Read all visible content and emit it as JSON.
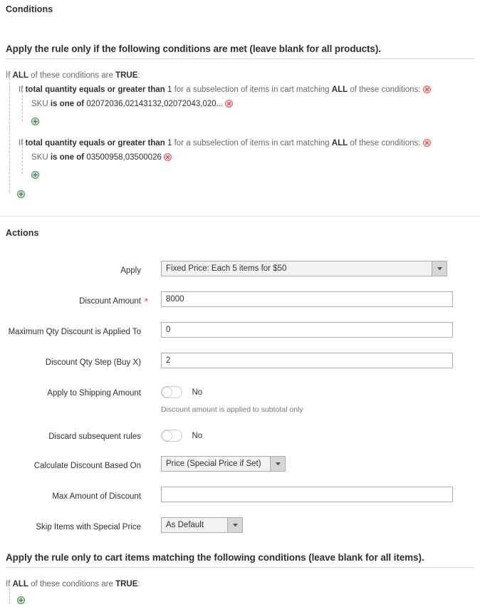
{
  "conditions_section": {
    "title": "Conditions",
    "description": "Apply the rule only if the following conditions are met (leave blank for all products).",
    "root": {
      "prefix": "If",
      "aggregator": "ALL",
      "middle": "of these conditions are",
      "value": "TRUE",
      "suffix": ":"
    },
    "groups": [
      {
        "prefix": "If",
        "attribute": "total quantity",
        "operator": "equals or greater than",
        "value": "1",
        "middle": "for a subselection of items in cart matching",
        "aggregator": "ALL",
        "suffix": "of these conditions:",
        "remove_icon": "remove-circle-icon",
        "children": [
          {
            "attribute": "SKU",
            "operator": "is one of",
            "value": "02072036,02143132,02072043,020...",
            "remove_icon": "remove-circle-icon"
          }
        ],
        "add_icon": "add-circle-icon"
      },
      {
        "prefix": "If",
        "attribute": "total quantity",
        "operator": "equals or greater than",
        "value": "1",
        "middle": "for a subselection of items in cart matching",
        "aggregator": "ALL",
        "suffix": "of these conditions:",
        "remove_icon": "remove-circle-icon",
        "children": [
          {
            "attribute": "SKU",
            "operator": "is one of",
            "value": "03500958,03500026",
            "remove_icon": "remove-circle-icon"
          }
        ],
        "add_icon": "add-circle-icon"
      }
    ],
    "root_add_icon": "add-circle-icon"
  },
  "actions_section": {
    "title": "Actions",
    "fields": {
      "apply": {
        "label": "Apply",
        "value": "Fixed Price: Each 5 items for $50",
        "arrow_icon": "chevron-down-icon"
      },
      "discount_amount": {
        "label": "Discount Amount",
        "required_marker": "*",
        "value": "8000"
      },
      "max_qty": {
        "label": "Maximum Qty Discount is Applied To",
        "value": "0"
      },
      "qty_step": {
        "label": "Discount Qty Step (Buy X)",
        "value": "2"
      },
      "apply_shipping": {
        "label": "Apply to Shipping Amount",
        "toggle_state": "No",
        "note": "Discount amount is applied to subtotal only"
      },
      "discard_rules": {
        "label": "Discard subsequent rules",
        "toggle_state": "No"
      },
      "calc_based_on": {
        "label": "Calculate Discount Based On",
        "value": "Price (Special Price if Set)",
        "arrow_icon": "chevron-down-icon"
      },
      "max_amount": {
        "label": "Max Amount of Discount",
        "value": ""
      },
      "skip_special": {
        "label": "Skip Items with Special Price",
        "value": "As Default",
        "arrow_icon": "chevron-down-icon"
      }
    }
  },
  "cart_conditions_section": {
    "description": "Apply the rule only to cart items matching the following conditions (leave blank for all items).",
    "root": {
      "prefix": "If",
      "aggregator": "ALL",
      "middle": "of these conditions are",
      "value": "TRUE",
      "suffix": ":"
    },
    "add_icon": "add-circle-icon"
  },
  "colors": {
    "remove_icon": "#e05b5b",
    "add_icon": "#4f8a5b",
    "required_star": "#e22626",
    "text": "#303030",
    "muted_text": "#6a6a6a",
    "rule_line": "#d6d6d6",
    "select_bg": "#f2f2f2"
  }
}
